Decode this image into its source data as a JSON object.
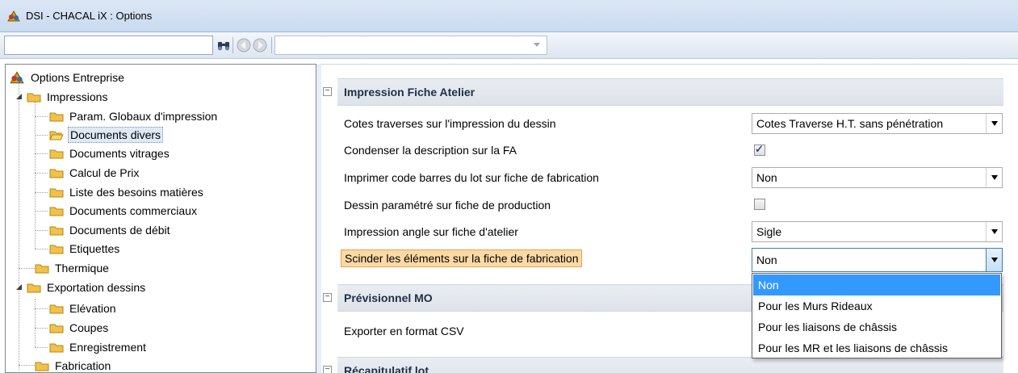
{
  "window": {
    "title": "DSI - CHACAL iX : Options",
    "app_icon": "chacal-app-icon"
  },
  "toolbar": {
    "search_value": "",
    "find_icon": "binoculars-icon",
    "back_icon": "back-arrow-icon",
    "forward_icon": "forward-arrow-icon",
    "nav_select_value": ""
  },
  "tree": {
    "root": "Options Entreprise",
    "impressions": "Impressions",
    "impressions_children": [
      "Param. Globaux d'impression",
      "Documents divers",
      "Documents vitrages",
      "Calcul de Prix",
      "Liste des besoins matières",
      "Documents commerciaux",
      "Documents de débit",
      "Etiquettes"
    ],
    "selected": "Documents divers",
    "thermique": "Thermique",
    "exportation": "Exportation dessins",
    "exportation_children": [
      "Elévation",
      "Coupes",
      "Enregistrement"
    ],
    "fabrication": "Fabrication"
  },
  "grid": {
    "cat_impression": "Impression Fiche Atelier",
    "props": [
      {
        "label": "Cotes traverses sur l'impression du dessin",
        "type": "combo",
        "value": "Cotes Traverse H.T. sans pénétration"
      },
      {
        "label": "Condenser la description sur la FA",
        "type": "checkbox",
        "checked": true
      },
      {
        "label": "Imprimer code barres du lot sur fiche de fabrication",
        "type": "combo",
        "value": "Non"
      },
      {
        "label": "Dessin paramétré sur fiche de production",
        "type": "checkbox",
        "checked": false
      },
      {
        "label": "Impression angle sur fiche d'atelier",
        "type": "combo",
        "value": "Sigle"
      },
      {
        "label": "Scinder les éléments sur la fiche de fabrication",
        "type": "combo",
        "value": "Non"
      }
    ],
    "cat_previsionnel": "Prévisionnel MO",
    "prop_export_csv": "Exporter en format CSV",
    "cat_recap": "Récapitulatif lot",
    "collapse_symbol": "−",
    "check_mark": "✓"
  },
  "dropdown": {
    "options": [
      "Non",
      "Pour les Murs Rideaux",
      "Pour les liaisons de châssis",
      "Pour les MR et les liaisons de châssis"
    ],
    "selected": "Non"
  }
}
